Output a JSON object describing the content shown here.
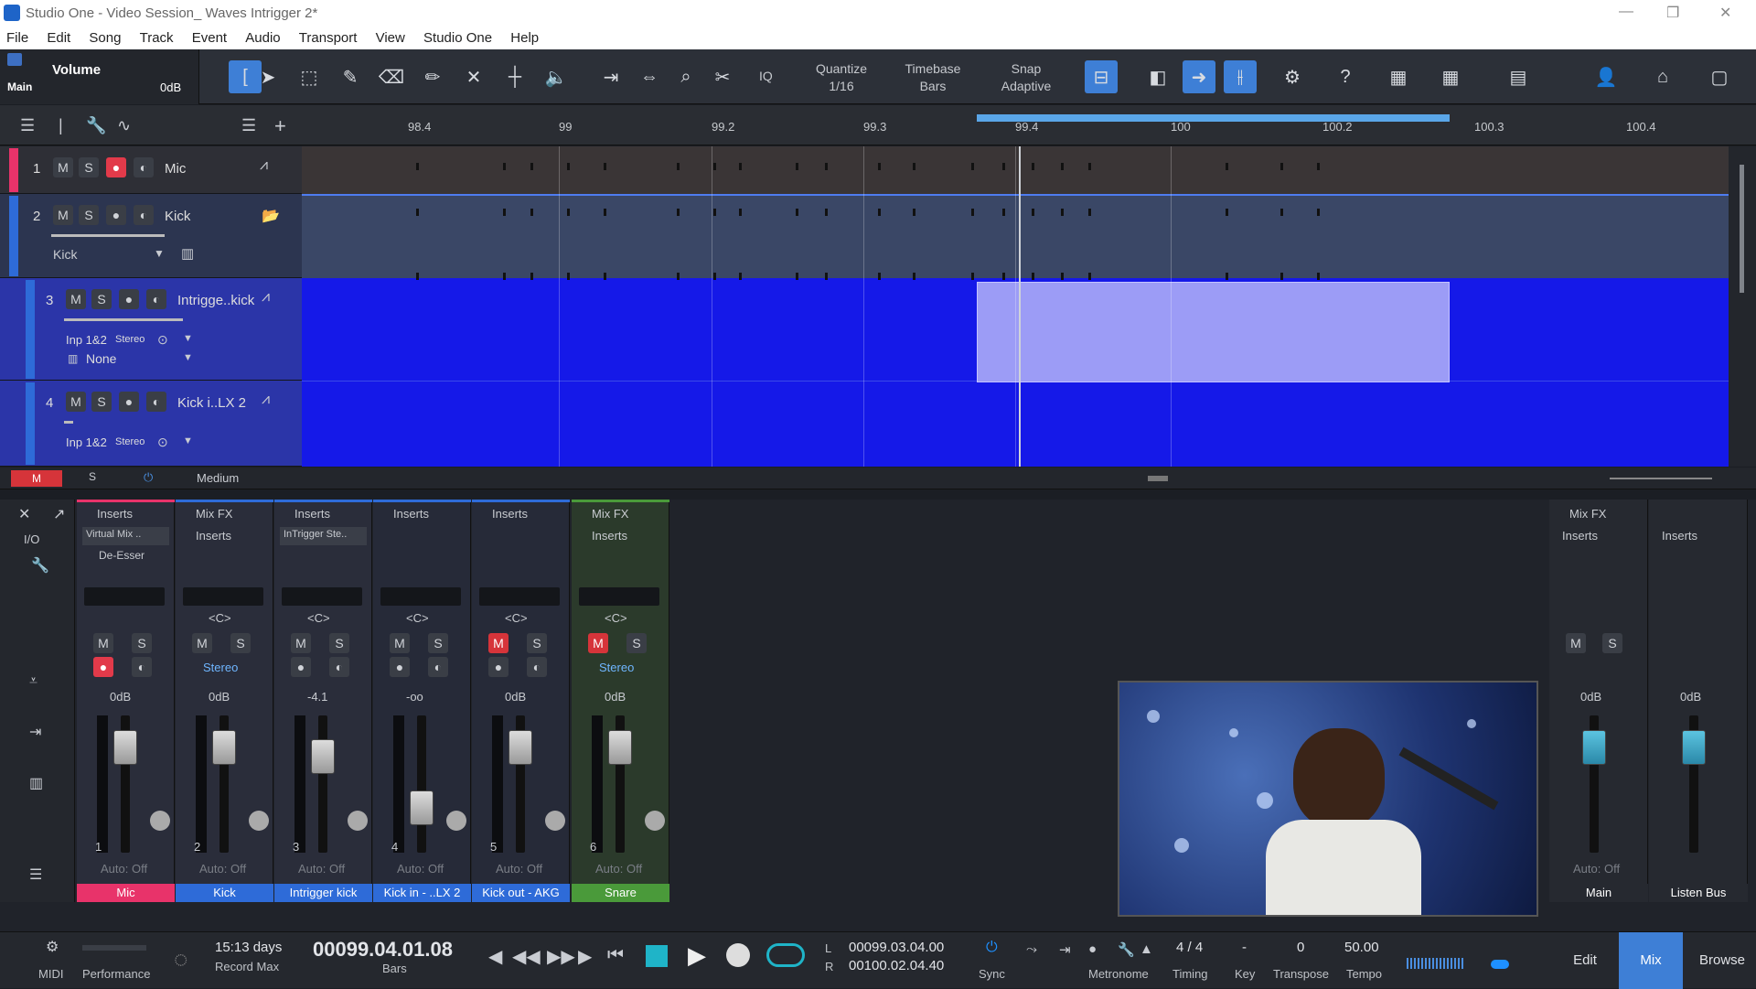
{
  "window": {
    "title": "Studio One - Video Session_ Waves Intrigger 2*"
  },
  "menu": [
    "File",
    "Edit",
    "Song",
    "Track",
    "Event",
    "Audio",
    "Transport",
    "View",
    "Studio One",
    "Help"
  ],
  "volume_panel": {
    "label": "Volume",
    "sub": "Main",
    "value": "0dB"
  },
  "toolbar": {
    "quantize_label": "Quantize",
    "quantize_value": "1/16",
    "timebase_label": "Timebase",
    "timebase_value": "Bars",
    "snap_label": "Snap",
    "snap_value": "Adaptive",
    "iq": "IQ"
  },
  "ruler": {
    "ticks": [
      "98.4",
      "99",
      "99.2",
      "99.3",
      "99.4",
      "100",
      "100.2",
      "100.3",
      "100.4"
    ]
  },
  "tracks": [
    {
      "num": "1",
      "name": "Mic",
      "color": "#e8336a"
    },
    {
      "num": "2",
      "name": "Kick",
      "preset": "Kick",
      "color": "#2e6bd8"
    },
    {
      "num": "3",
      "name": "Intrigge..kick",
      "input": "Inp 1&2",
      "input_mode": "Stereo",
      "output": "None",
      "color": "#2e6bd8"
    },
    {
      "num": "4",
      "name": "Kick i..LX 2",
      "input": "Inp 1&2",
      "input_mode": "Stereo",
      "color": "#2e6bd8"
    }
  ],
  "track_bottom": {
    "m": "M",
    "s": "S",
    "size": "Medium"
  },
  "mixer": {
    "io_label": "I/O",
    "strips": [
      {
        "num": "1",
        "header": "Inserts",
        "insert1": "Virtual Mix ..",
        "insert2": "De-Esser",
        "pan": "",
        "volume": "0dB",
        "auto": "Auto: Off",
        "label": "Mic",
        "label_color": "#e8336a",
        "mute_on": false,
        "rec_on": true
      },
      {
        "num": "2",
        "header": "Mix FX",
        "sub": "Inserts",
        "pan": "<C>",
        "mode": "Stereo",
        "volume": "0dB",
        "auto": "Auto: Off",
        "label": "Kick",
        "label_color": "#2e6bd8",
        "mute_on": false
      },
      {
        "num": "3",
        "header": "Inserts",
        "insert1": "InTrigger Ste..",
        "pan": "<C>",
        "volume": "-4.1",
        "auto": "Auto: Off",
        "label": "Intrigger kick",
        "label_color": "#2e6bd8",
        "mute_on": false
      },
      {
        "num": "4",
        "header": "Inserts",
        "pan": "<C>",
        "volume": "-oo",
        "auto": "Auto: Off",
        "label": "Kick in - ..LX 2",
        "label_color": "#2e6bd8",
        "mute_on": false
      },
      {
        "num": "5",
        "header": "Inserts",
        "pan": "<C>",
        "volume": "0dB",
        "auto": "Auto: Off",
        "label": "Kick out - AKG",
        "label_color": "#2e6bd8",
        "mute_on": true
      },
      {
        "num": "6",
        "header": "Mix FX",
        "sub": "Inserts",
        "pan": "<C>",
        "mode": "Stereo",
        "volume": "0dB",
        "auto": "Auto: Off",
        "label": "Snare",
        "label_color": "#4a9a3a",
        "mute_on": true
      }
    ],
    "main": {
      "header": "Mix FX",
      "sub": "Inserts",
      "volume": "0dB",
      "auto": "Auto: Off",
      "label": "Main"
    },
    "listen": {
      "sub": "Inserts",
      "volume": "0dB",
      "label": "Listen Bus"
    }
  },
  "transport": {
    "midi": "MIDI",
    "performance": "Performance",
    "record_max_value": "15:13 days",
    "record_max_label": "Record Max",
    "position": "00099.04.01.08",
    "position_unit": "Bars",
    "loop_l": "00099.03.04.00",
    "loop_r": "00100.02.04.40",
    "l": "L",
    "r": "R",
    "sync": "Sync",
    "metronome": "Metronome",
    "timing_value": "4 / 4",
    "timing_label": "Timing",
    "key_value": "-",
    "key_label": "Key",
    "transpose_value": "0",
    "transpose_label": "Transpose",
    "tempo_value": "50.00",
    "tempo_label": "Tempo",
    "edit": "Edit",
    "mix": "Mix",
    "browse": "Browse"
  }
}
